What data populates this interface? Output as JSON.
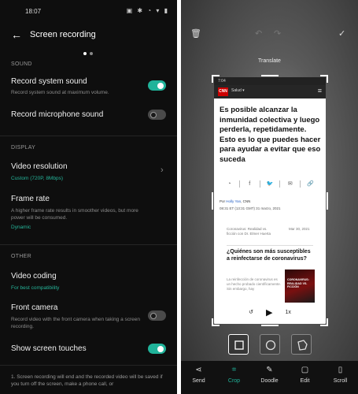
{
  "left": {
    "status_time": "18:07",
    "header_title": "Screen recording",
    "sections": {
      "sound": "SOUND",
      "display": "DISPLAY",
      "other": "OTHER"
    },
    "items": {
      "system_sound": {
        "label": "Record system sound",
        "sub": "Record system sound at maximum volume.",
        "on": true
      },
      "mic_sound": {
        "label": "Record microphone sound",
        "on": false
      },
      "video_resolution": {
        "label": "Video resolution",
        "value": "Custom (720P, 8Mbps)"
      },
      "frame_rate": {
        "label": "Frame rate",
        "sub": "A higher frame rate results in smoother videos, but more power will be consumed.",
        "value": "Dynamic"
      },
      "video_coding": {
        "label": "Video coding",
        "value": "For best compatibility"
      },
      "front_camera": {
        "label": "Front camera",
        "sub": "Record video with the front camera when taking a screen recording.",
        "on": false
      },
      "screen_touches": {
        "label": "Show screen touches",
        "on": true
      }
    },
    "footer": "1. Screen recording will end and the recorded video will be saved if you turn off the screen, make a phone call, or"
  },
  "right": {
    "translate": "Translate",
    "inner": {
      "time": "7:04",
      "brand": "CNN",
      "section": "Salud",
      "headline": "Es posible alcanzar la inmunidad colectiva y luego perderla, repetidamente. Esto es lo que puedes hacer para ayudar a evitar que eso suceda",
      "by_prefix": "Por",
      "by_author": "Holly Yan",
      "by_suffix": ", CNN",
      "date": "08:31 ET (13:31 GMT) 31 marzo, 2021",
      "related1": "Coronavirus: Realidad vs. ficción con Dr. Elmer Huerta",
      "related1_date": "Mar 30, 2021",
      "related2": "¿Quiénes son más susceptibles a reinfectarse de coronavirus?",
      "related3": "La reinfección de coronavirus es un hecho probado científicamente. Sin embargo, hay",
      "thumb_text": "CORONAVIRUS: REALIDAD VS. FICCIÓN",
      "speed": "1x"
    },
    "toolbar": {
      "send": "Send",
      "crop": "Crop",
      "doodle": "Doodle",
      "edit": "Edit",
      "scroll": "Scroll"
    },
    "colors": {
      "accent": "#20b39a"
    }
  }
}
